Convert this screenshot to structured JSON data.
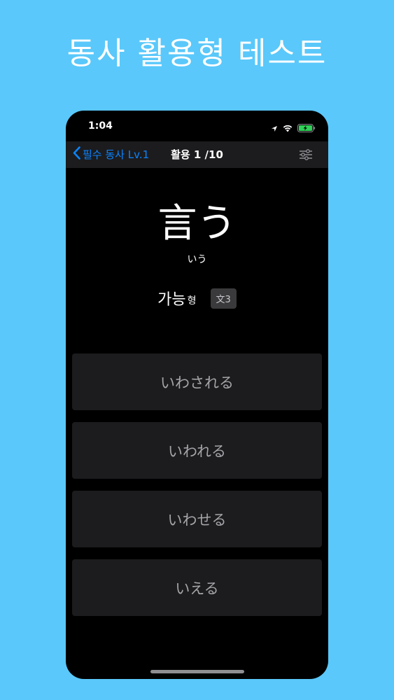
{
  "promo": {
    "title": "동사 활용형 테스트"
  },
  "status_bar": {
    "time": "1:04",
    "icons": [
      "location-arrow-icon",
      "wifi-icon",
      "battery-charging-icon"
    ]
  },
  "nav": {
    "back_label": "필수 동사 Lv.1",
    "title": "활용 1 /10",
    "settings_icon": "sliders-icon"
  },
  "question": {
    "verb": "言う",
    "reading": "いう",
    "form_name": "가능",
    "form_suffix": "형",
    "badge": "文3"
  },
  "options": [
    {
      "label": "いわされる"
    },
    {
      "label": "いわれる"
    },
    {
      "label": "いわせる"
    },
    {
      "label": "いえる"
    }
  ],
  "colors": {
    "background": "#5ac8fa",
    "screen": "#000000",
    "nav_bar": "#1c1c1e",
    "accent": "#0a84ff",
    "option_bg": "#1c1c1e",
    "option_text": "#a5a5aa",
    "battery": "#30d158"
  }
}
